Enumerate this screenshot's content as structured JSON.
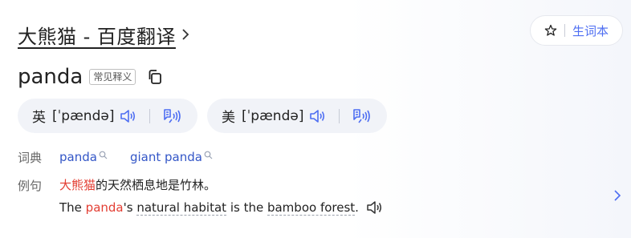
{
  "header": {
    "title": "大熊猫 - 百度翻译",
    "favorite_label": "生词本"
  },
  "entry": {
    "word": "panda",
    "tag": "常见释义"
  },
  "pronunciations": [
    {
      "lang": "英",
      "ipa": "[ˈpændə]"
    },
    {
      "lang": "美",
      "ipa": "[ˈpændə]"
    }
  ],
  "dictionary": {
    "label": "词典",
    "items": [
      "panda",
      "giant panda"
    ]
  },
  "example": {
    "label": "例句",
    "cn_highlight": "大熊猫",
    "cn_rest": "的天然栖息地是竹林。",
    "en_before": "The ",
    "en_highlight": "panda",
    "en_after1": "'s ",
    "en_phrase1": "natural habitat",
    "en_mid": " is the ",
    "en_phrase2": "bamboo forest",
    "en_end": "."
  },
  "colors": {
    "accent": "#4e6ef2",
    "link": "#3356c7",
    "highlight": "#e33e33",
    "pill_bg": "#f1f3f8"
  },
  "icons": {
    "title_chevron": "chevron-right-icon",
    "favorite": "star-icon",
    "copy": "copy-icon",
    "speaker": "speaker-icon",
    "read_along": "mic-waves-icon",
    "search": "search-icon",
    "next": "chevron-right-icon"
  }
}
